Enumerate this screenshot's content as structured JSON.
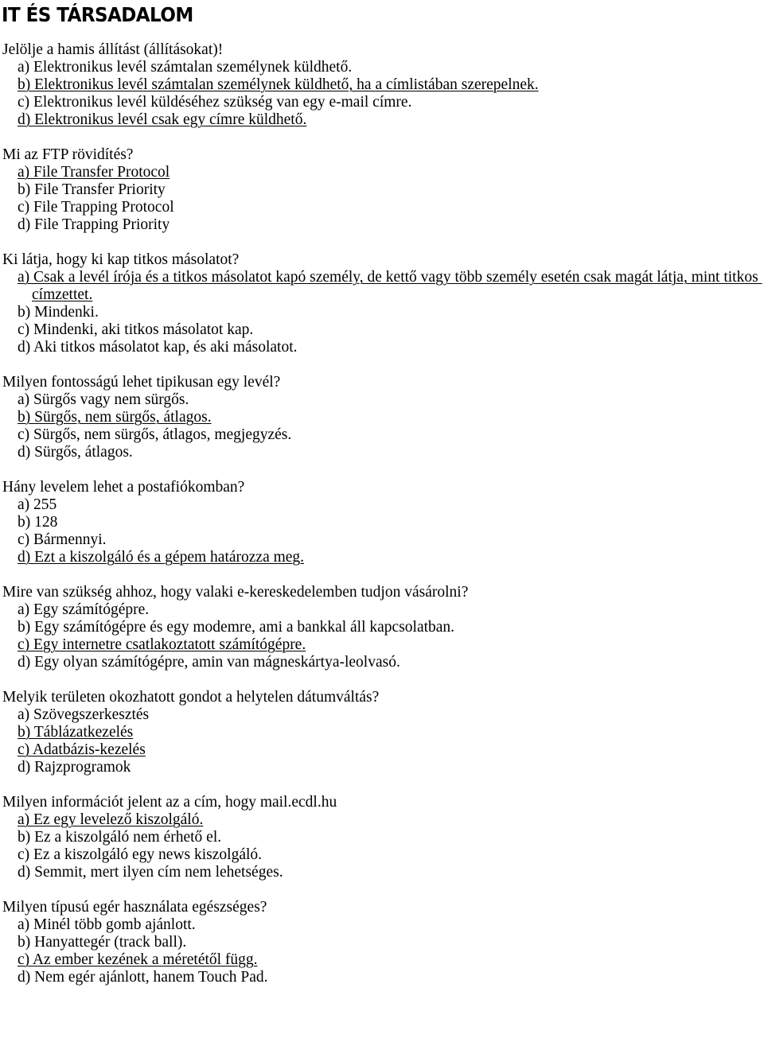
{
  "document": {
    "title": "IT ÉS TÁRSADALOM",
    "language": "hu",
    "questions": [
      {
        "id": "q1",
        "text": "Jelölje a hamis állítást (állításokat)!",
        "options": [
          {
            "label": "a) Elektronikus levél számtalan személynek küldhető.",
            "correct": false
          },
          {
            "label": "b) Elektronikus levél számtalan személynek küldhető, ha a címlistában szerepelnek.",
            "correct": true
          },
          {
            "label": "c) Elektronikus levél küldéséhez szükség van egy e-mail címre.",
            "correct": false
          },
          {
            "label": "d) Elektronikus levél csak egy címre küldhető.",
            "correct": true
          }
        ]
      },
      {
        "id": "q2",
        "text": "Mi az FTP rövidítés?",
        "options": [
          {
            "label": "a) File Transfer Protocol",
            "correct": true
          },
          {
            "label": "b) File Transfer Priority",
            "correct": false
          },
          {
            "label": "c) File Trapping Protocol",
            "correct": false
          },
          {
            "label": "d) File Trapping Priority",
            "correct": false
          }
        ]
      },
      {
        "id": "q3",
        "text": "Ki látja, hogy ki kap titkos másolatot?",
        "options": [
          {
            "label": "a) Csak a levél írója és a titkos másolatot kapó személy, de kettő vagy több személy esetén csak magát látja, mint titkos címzettet.",
            "correct": true
          },
          {
            "label": "b) Mindenki.",
            "correct": false
          },
          {
            "label": "c) Mindenki, aki titkos másolatot kap.",
            "correct": false
          },
          {
            "label": "d) Aki titkos másolatot kap, és aki másolatot.",
            "correct": false
          }
        ]
      },
      {
        "id": "q4",
        "text": "Milyen fontosságú lehet tipikusan egy levél?",
        "options": [
          {
            "label": "a) Sürgős vagy nem sürgős.",
            "correct": false
          },
          {
            "label": "b) Sürgős, nem sürgős, átlagos.",
            "correct": true
          },
          {
            "label": "c) Sürgős, nem sürgős, átlagos, megjegyzés.",
            "correct": false
          },
          {
            "label": "d) Sürgős, átlagos.",
            "correct": false
          }
        ]
      },
      {
        "id": "q5",
        "text": "Hány levelem lehet a postafiókomban?",
        "options": [
          {
            "label": "a) 255",
            "correct": false
          },
          {
            "label": "b) 128",
            "correct": false
          },
          {
            "label": "c) Bármennyi.",
            "correct": false
          },
          {
            "label": "d) Ezt a kiszolgáló és a gépem határozza meg.",
            "correct": true
          }
        ]
      },
      {
        "id": "q6",
        "text": "Mire van szükség ahhoz, hogy valaki e-kereskedelemben tudjon vásárolni?",
        "options": [
          {
            "label": "a) Egy számítógépre.",
            "correct": false
          },
          {
            "label": "b) Egy számítógépre és egy modemre, ami a bankkal áll kapcsolatban.",
            "correct": false
          },
          {
            "label": "c) Egy internetre csatlakoztatott számítógépre.",
            "correct": true
          },
          {
            "label": "d) Egy olyan számítógépre, amin van mágneskártya-leolvasó.",
            "correct": false
          }
        ]
      },
      {
        "id": "q7",
        "text": "Melyik területen okozhatott gondot a helytelen dátumváltás?",
        "options": [
          {
            "label": "a) Szövegszerkesztés",
            "correct": false
          },
          {
            "label": "b) Táblázatkezelés",
            "correct": true
          },
          {
            "label": "c) Adatbázis-kezelés",
            "correct": true
          },
          {
            "label": "d) Rajzprogramok",
            "correct": false
          }
        ]
      },
      {
        "id": "q8",
        "text": "Milyen információt jelent az a cím, hogy mail.ecdl.hu",
        "options": [
          {
            "label": "a) Ez egy levelező kiszolgáló.",
            "correct": true
          },
          {
            "label": "b) Ez a kiszolgáló nem érhető el.",
            "correct": false
          },
          {
            "label": "c) Ez a kiszolgáló egy news kiszolgáló.",
            "correct": false
          },
          {
            "label": "d) Semmit, mert ilyen cím nem lehetséges.",
            "correct": false
          }
        ]
      },
      {
        "id": "q9",
        "text": "Milyen típusú egér használata egészséges?",
        "options": [
          {
            "label": "a) Minél több gomb ajánlott.",
            "correct": false
          },
          {
            "label": "b) Hanyattegér (track ball).",
            "correct": false
          },
          {
            "label": "c) Az ember kezének a méretétől függ.",
            "correct": true
          },
          {
            "label": "d) Nem egér ajánlott, hanem Touch Pad.",
            "correct": false
          }
        ]
      }
    ]
  }
}
